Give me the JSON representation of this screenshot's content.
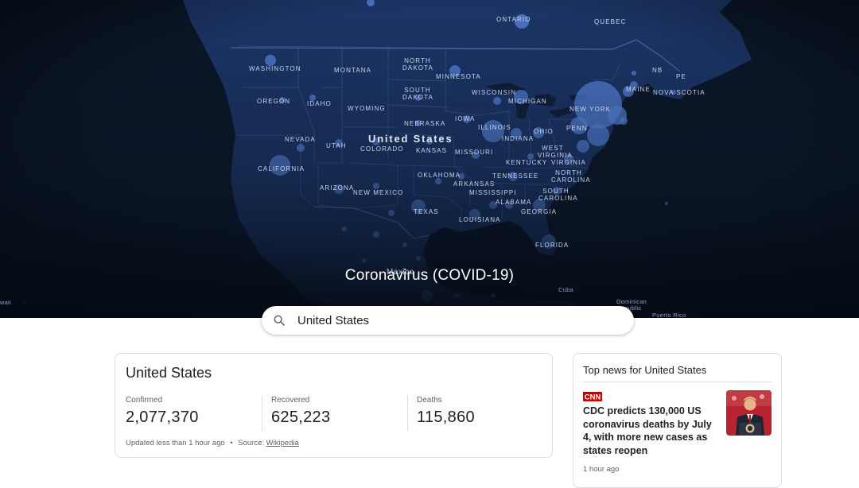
{
  "page": {
    "title": "Coronavirus (COVID-19)"
  },
  "search": {
    "icon": "search-icon",
    "value": "United States"
  },
  "map": {
    "country_label": "United States",
    "mexico_label": "Mexico",
    "state_labels": [
      "WASHINGTON",
      "OREGON",
      "CALIFORNIA",
      "NEVADA",
      "IDAHO",
      "MONTANA",
      "WYOMING",
      "UTAH",
      "COLORADO",
      "ARIZONA",
      "NEW MEXICO",
      "NORTH DAKOTA",
      "SOUTH DAKOTA",
      "NEBRASKA",
      "KANSAS",
      "OKLAHOMA",
      "TEXAS",
      "MINNESOTA",
      "IOWA",
      "MISSOURI",
      "ARKANSAS",
      "LOUISIANA",
      "WISCONSIN",
      "ILLINOIS",
      "MISSISSIPPI",
      "ALABAMA",
      "TENNESSEE",
      "KENTUCKY",
      "INDIANA",
      "OHIO",
      "MICHIGAN",
      "GEORGIA",
      "FLORIDA",
      "SOUTH CAROLINA",
      "NORTH CAROLINA",
      "VIRGINIA",
      "WEST VIRGINIA",
      "PENN",
      "NEW YORK",
      "MAINE",
      "NB",
      "PE",
      "NOVA SCOTIA",
      "ONTARIO",
      "QUEBEC",
      "Cuba",
      "Dominican Republic",
      "Puerto Rico",
      "Hawaii"
    ],
    "colors": {
      "ocean": "#0b1628",
      "land": "#1c3668",
      "border": "#3c5b94",
      "bubble": "#5b8ae6"
    }
  },
  "stats": {
    "title": "United States",
    "confirmed_label": "Confirmed",
    "confirmed_value": "2,077,370",
    "recovered_label": "Recovered",
    "recovered_value": "625,223",
    "deaths_label": "Deaths",
    "deaths_value": "115,860",
    "updated_text": "Updated less than 1 hour ago",
    "separator": "•",
    "source_prefix": "Source:",
    "source_link": "Wikipedia"
  },
  "news": {
    "header": "Top news for United States",
    "source_logo": "CNN",
    "headline": "CDC predicts 130,000 US coronavirus deaths by July 4, with more new cases as states reopen",
    "time": "1 hour ago"
  }
}
